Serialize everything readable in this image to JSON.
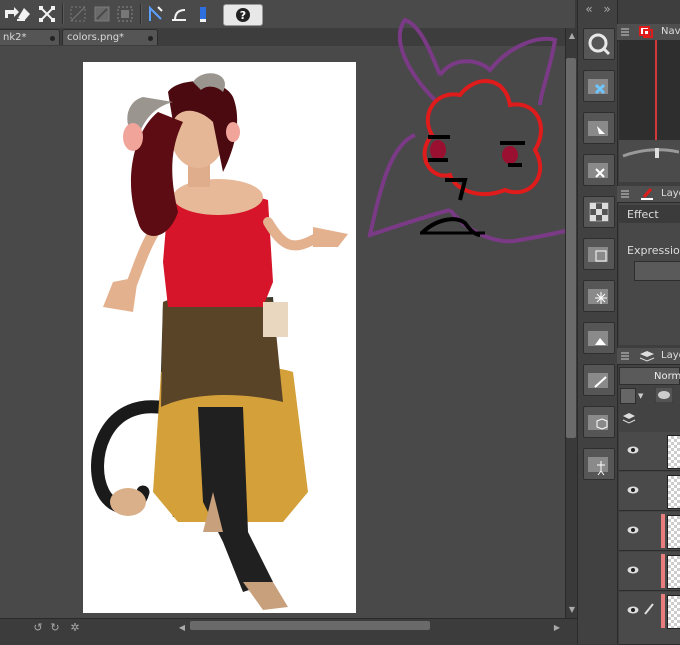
{
  "tabs": [
    {
      "label": "nk2*"
    },
    {
      "label": "colors.png*"
    }
  ],
  "toolbar": {
    "help_label": "?"
  },
  "panels": {
    "navigator_title": "Navi",
    "layer_property_title": "Laye",
    "effect_label": "Effect",
    "expression_label": "Expression",
    "layer_title": "Laye",
    "blend_mode": "Norma"
  },
  "colors": {
    "panel_bg": "#3e3e3e",
    "canvas_bg": "#494949",
    "accent_red": "#e01b1b",
    "doodle_purple": "#7a3a86",
    "layer_marker": "#e87d7d"
  },
  "icons": [
    "zoom-icon",
    "navigator-icon",
    "layer-property-icon",
    "layer-icon",
    "eye-icon",
    "help-icon"
  ]
}
